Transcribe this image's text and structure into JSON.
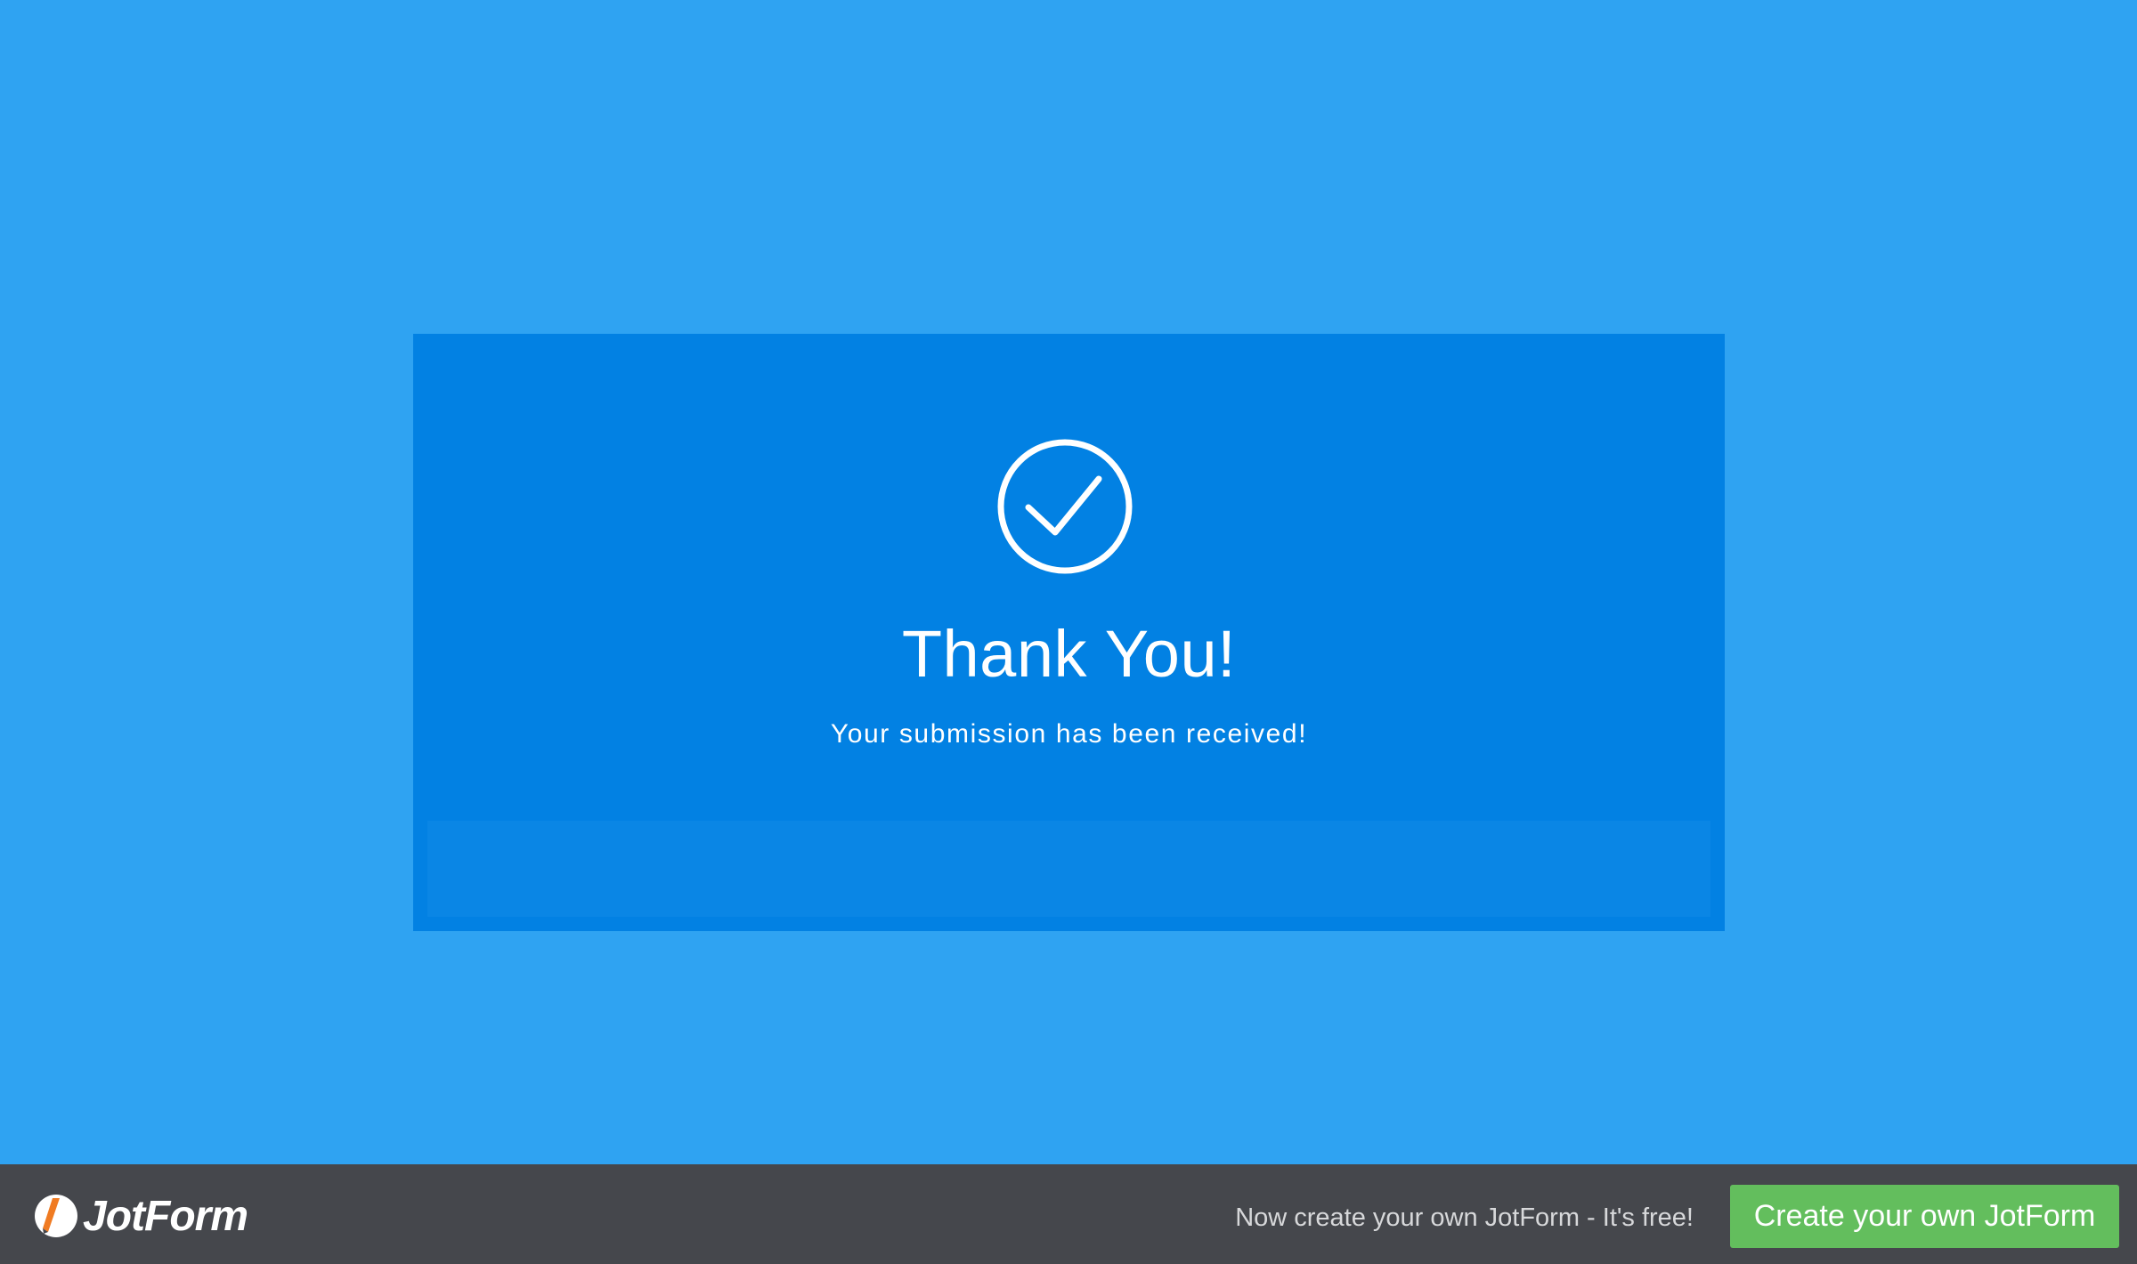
{
  "thank_you": {
    "title": "Thank You!",
    "message": "Your submission has been received!",
    "icon": "check-circle-icon"
  },
  "footer": {
    "logo_text": "JotForm",
    "promo_text": "Now create your own JotForm - It's free!",
    "cta_label": "Create your own JotForm"
  },
  "colors": {
    "page_background": "#2fa3f2",
    "card_background": "#0281e3",
    "card_footer_background": "#0a86e5",
    "bottom_bar_background": "#45474c",
    "cta_background": "#63be5d",
    "logo_accent": "#f07b22"
  }
}
